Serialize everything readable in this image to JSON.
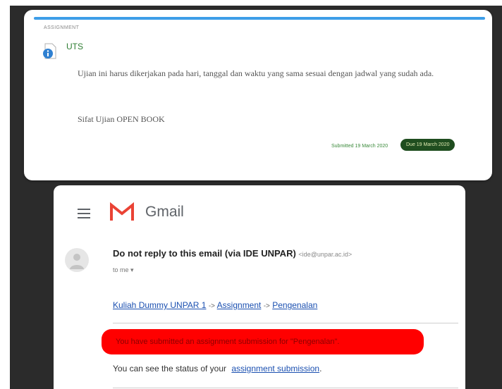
{
  "assignment": {
    "type_label": "ASSIGNMENT",
    "icon": "assignment-info-icon",
    "title": "UTS",
    "description": "Ujian ini harus dikerjakan pada hari, tanggal dan waktu yang sama sesuai dengan jadwal yang sudah ada.",
    "note": "Sifat Ujian OPEN BOOK",
    "submitted_text": "Submitted 19 March 2020",
    "due_badge": "Due 19 March 2020",
    "accent_color": "#3d9ee8"
  },
  "gmail": {
    "menu_icon": "hamburger-menu-icon",
    "logo_icon": "gmail-m-logo-icon",
    "app_name": "Gmail",
    "sender_name": "Do not reply to this email (via IDE UNPAR)",
    "sender_email": "<ide@unpar.ac.id>",
    "recipient": "to me",
    "breadcrumb": {
      "course": "Kuliah Dummy UNPAR 1",
      "sep1": "->",
      "section": "Assignment",
      "sep2": "->",
      "item": "Pengenalan"
    },
    "alert_text": "You have submitted an assignment submission for \"Pengenalan\".",
    "status_prefix": "You can see the status of your",
    "status_link": "assignment submission",
    "status_suffix": ".",
    "alert_color": "#ff0000"
  }
}
